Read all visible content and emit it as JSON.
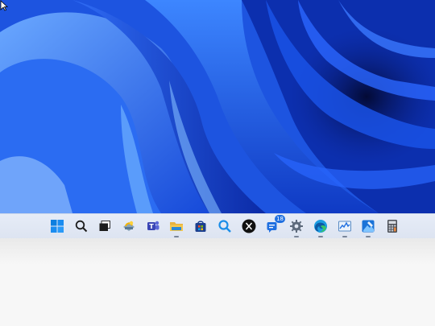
{
  "wallpaper": {
    "name": "windows-11-bloom"
  },
  "taskbar": {
    "items": [
      {
        "name": "start",
        "icon": "windows-logo-icon",
        "running": false
      },
      {
        "name": "search",
        "icon": "search-icon",
        "running": false
      },
      {
        "name": "task-view",
        "icon": "task-view-icon",
        "running": false
      },
      {
        "name": "widgets",
        "icon": "widgets-icon",
        "running": false
      },
      {
        "name": "teams",
        "icon": "teams-icon",
        "running": false
      },
      {
        "name": "file-explorer",
        "icon": "folder-icon",
        "running": true
      },
      {
        "name": "microsoft-store",
        "icon": "store-icon",
        "running": false
      },
      {
        "name": "search-app",
        "icon": "magnifier-icon",
        "running": false
      },
      {
        "name": "x",
        "icon": "x-logo-icon",
        "running": false
      },
      {
        "name": "notifications-app",
        "icon": "chat-badge-icon",
        "running": false,
        "badge": "18"
      },
      {
        "name": "settings",
        "icon": "gear-icon",
        "running": true
      },
      {
        "name": "edge",
        "icon": "edge-icon",
        "running": true
      },
      {
        "name": "resource-monitor",
        "icon": "performance-chart-icon",
        "running": true
      },
      {
        "name": "photo-editor",
        "icon": "image-editor-icon",
        "running": true
      },
      {
        "name": "calculator",
        "icon": "calculator-icon",
        "running": false
      }
    ]
  },
  "colors": {
    "accent": "#1f6fe0",
    "taskbar": "#e2e8f4"
  }
}
